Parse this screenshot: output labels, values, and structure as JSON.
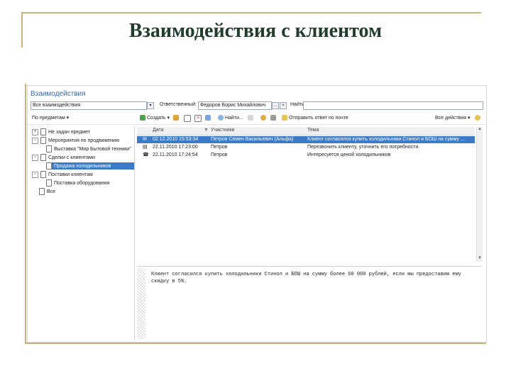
{
  "slide": {
    "title": "Взаимодействия с клиентом"
  },
  "window": {
    "title": "Взаимодействия"
  },
  "filter": {
    "search_value": "Все взаимодействия",
    "select_label": "Ответственный:",
    "select_value": "Федоров Борис Михайлович",
    "find_label": "Найти:",
    "find_value": ""
  },
  "toolbar": {
    "by_topic": "По предметам",
    "create": "Создать",
    "find": "Найти...",
    "reply": "Отправить ответ по почте",
    "actions": "Все действия"
  },
  "tree": [
    {
      "label": "Не задан предмет",
      "icon": "plus"
    },
    {
      "label": "Мероприятия по продвижению",
      "icon": "minus"
    },
    {
      "label": "Выставка \"Мир Бытовой техники\"",
      "icon": "doc"
    },
    {
      "label": "Сделки с клиентами",
      "icon": "minus"
    },
    {
      "label": "Продажа холодильников",
      "icon": "doc",
      "selected": true
    },
    {
      "label": "Поставки клиентам",
      "icon": "minus"
    },
    {
      "label": "Поставка оборудования",
      "icon": "doc"
    },
    {
      "label": "Все",
      "icon": "doc"
    }
  ],
  "grid": {
    "headers": [
      "Дата",
      "Участники",
      "Тема"
    ],
    "rows": [
      {
        "date": "02.12.2010 15:53:34",
        "participants": "Петров Семен Васильевич (Альфа)",
        "subject": "Клиент согласился купить холодильники Стинол и БОШ на сумму ...",
        "icon": "mail-icon",
        "selected": true
      },
      {
        "date": "22.11.2010 17:23:00",
        "participants": "Петров",
        "subject": "Перезвонить клиенту, уточнить его потребности.",
        "icon": "task-icon",
        "selected": false
      },
      {
        "date": "22.11.2010 17:24:54",
        "participants": "Петров",
        "subject": "Интересуется ценой холодильников",
        "icon": "phone-icon",
        "selected": false
      }
    ]
  },
  "memo": {
    "text": "Клиент согласился купить холодильники Стинол и БОШ на сумму более 60 000 рублей, если мы предоставим ему скидку в 5%."
  },
  "colors": {
    "accent": "#3b7bc8",
    "title": "#1f3d2a",
    "rule": "#c8b27a"
  }
}
